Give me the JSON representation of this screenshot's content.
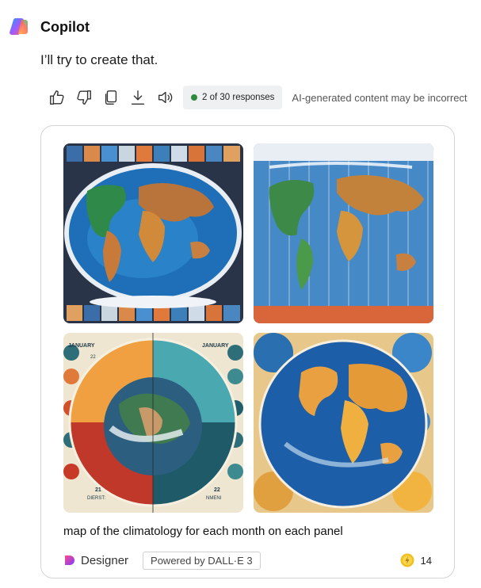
{
  "app": {
    "name": "Copilot",
    "logo_icon": "copilot-logo-icon"
  },
  "message": {
    "text": "I’ll try to create that."
  },
  "actions": {
    "icons": [
      "thumbs-up-icon",
      "thumbs-down-icon",
      "copy-icon",
      "download-icon",
      "speaker-icon"
    ],
    "responses_label": "2 of 30 responses",
    "status_color": "#2e8b3d",
    "disclaimer": "AI-generated content may be incorrect"
  },
  "result": {
    "images": [
      {
        "name": "generated-image-1",
        "labels": []
      },
      {
        "name": "generated-image-2",
        "labels": []
      },
      {
        "name": "generated-image-3",
        "labels": [
          "JANUARY",
          "JANUARY",
          "22",
          "21",
          "22",
          "DIERST:",
          "NMENI"
        ]
      },
      {
        "name": "generated-image-4",
        "labels": []
      }
    ],
    "caption": "map of the climatology for each month on each panel",
    "designer_label": "Designer",
    "powered_by": "Powered by DALL·E 3",
    "boost_count": "14"
  },
  "colors": {
    "accent": "#1a73c8",
    "coin": "#f0c020"
  }
}
